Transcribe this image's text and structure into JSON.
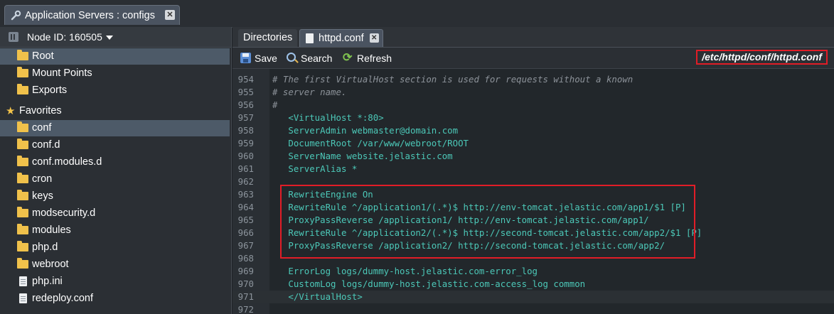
{
  "window": {
    "tab_title": "Application Servers : configs"
  },
  "sidebar": {
    "node_label": "Node ID: 160505",
    "items": [
      {
        "label": "Root",
        "icon": "folder-icon",
        "selected": true
      },
      {
        "label": "Mount Points",
        "icon": "folder-icon"
      },
      {
        "label": "Exports",
        "icon": "folder-icon"
      }
    ],
    "favorites_label": "Favorites",
    "favorites": [
      {
        "label": "conf",
        "icon": "folder-icon",
        "selected": true
      },
      {
        "label": "conf.d",
        "icon": "folder-icon"
      },
      {
        "label": "conf.modules.d",
        "icon": "folder-icon"
      },
      {
        "label": "cron",
        "icon": "folder-icon"
      },
      {
        "label": "keys",
        "icon": "folder-icon"
      },
      {
        "label": "modsecurity.d",
        "icon": "folder-icon"
      },
      {
        "label": "modules",
        "icon": "folder-icon"
      },
      {
        "label": "php.d",
        "icon": "folder-icon"
      },
      {
        "label": "webroot",
        "icon": "folder-icon"
      },
      {
        "label": "php.ini",
        "icon": "file-icon"
      },
      {
        "label": "redeploy.conf",
        "icon": "file-icon"
      }
    ]
  },
  "tabs": {
    "directories": "Directories",
    "file": "httpd.conf"
  },
  "toolbar": {
    "save": "Save",
    "search": "Search",
    "refresh": "Refresh",
    "path": "/etc/httpd/conf/httpd.conf"
  },
  "editor": {
    "lines": [
      {
        "n": "954",
        "text": "# The first VirtualHost section is used for requests without a known",
        "kind": "comment"
      },
      {
        "n": "955",
        "text": "# server name.",
        "kind": "comment"
      },
      {
        "n": "956",
        "text": "#",
        "kind": "comment"
      },
      {
        "n": "957",
        "text": "   <VirtualHost *:80>",
        "kind": "tag"
      },
      {
        "n": "958",
        "text": "   ServerAdmin webmaster@domain.com",
        "kind": "code"
      },
      {
        "n": "959",
        "text": "   DocumentRoot /var/www/webroot/ROOT",
        "kind": "code"
      },
      {
        "n": "960",
        "text": "   ServerName website.jelastic.com",
        "kind": "code"
      },
      {
        "n": "961",
        "text": "   ServerAlias *",
        "kind": "code"
      },
      {
        "n": "962",
        "text": "",
        "kind": "code"
      },
      {
        "n": "963",
        "text": "   RewriteEngine On",
        "kind": "code"
      },
      {
        "n": "964",
        "text": "   RewriteRule ^/application1/(.*)$ http://env-tomcat.jelastic.com/app1/$1 [P]",
        "kind": "code"
      },
      {
        "n": "965",
        "text": "   ProxyPassReverse /application1/ http://env-tomcat.jelastic.com/app1/",
        "kind": "code"
      },
      {
        "n": "966",
        "text": "   RewriteRule ^/application2/(.*)$ http://second-tomcat.jelastic.com/app2/$1 [P]",
        "kind": "code"
      },
      {
        "n": "967",
        "text": "   ProxyPassReverse /application2/ http://second-tomcat.jelastic.com/app2/",
        "kind": "code"
      },
      {
        "n": "968",
        "text": "",
        "kind": "code"
      },
      {
        "n": "969",
        "text": "   ErrorLog logs/dummy-host.jelastic.com-error_log",
        "kind": "code"
      },
      {
        "n": "970",
        "text": "   CustomLog logs/dummy-host.jelastic.com-access_log common",
        "kind": "code"
      },
      {
        "n": "971",
        "text": "   </VirtualHost>",
        "kind": "tag",
        "current": true
      },
      {
        "n": "972",
        "text": "",
        "kind": "code"
      }
    ]
  },
  "colors": {
    "highlight_box": "#e11d27",
    "code_text": "#4cc8b8",
    "comment_text": "#8c9299"
  }
}
